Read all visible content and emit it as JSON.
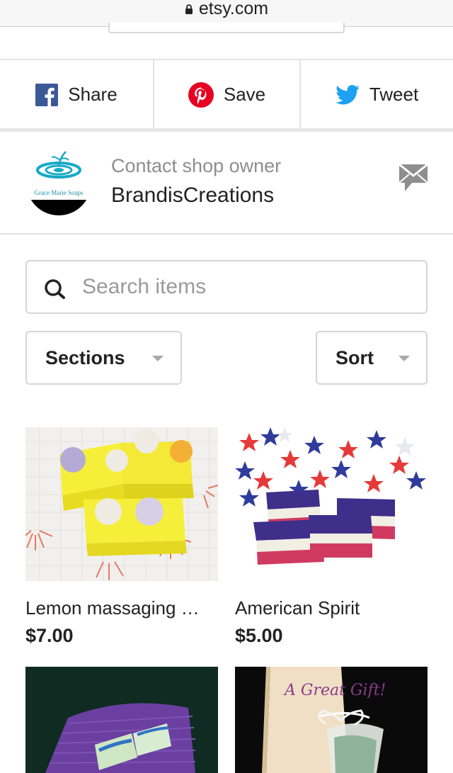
{
  "browser": {
    "url": "etsy.com"
  },
  "share": {
    "items": [
      {
        "label": "Share",
        "icon": "facebook-icon",
        "color": "#3b5998"
      },
      {
        "label": "Save",
        "icon": "pinterest-icon",
        "color": "#e60023"
      },
      {
        "label": "Tweet",
        "icon": "twitter-icon",
        "color": "#1da1f2"
      }
    ]
  },
  "shop": {
    "contact_label": "Contact shop owner",
    "name": "BrandisCreations",
    "logo_text": "Grace Marie Soaps"
  },
  "search": {
    "placeholder": "Search items"
  },
  "filters": {
    "sections_label": "Sections",
    "sort_label": "Sort"
  },
  "products": [
    {
      "title": "Lemon massaging …",
      "price": "$7.00"
    },
    {
      "title": "American Spirit",
      "price": "$5.00"
    },
    {
      "title": "",
      "price": ""
    },
    {
      "title": "",
      "price": "",
      "image_text": "A Great Gift!"
    }
  ]
}
